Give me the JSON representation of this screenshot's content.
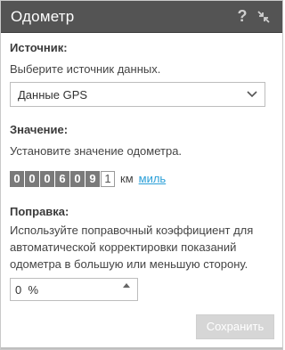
{
  "header": {
    "title": "Одометр",
    "help_symbol": "?"
  },
  "source": {
    "label": "Источник:",
    "hint": "Выберите источник данных.",
    "selected": "Данные GPS"
  },
  "value": {
    "label": "Значение:",
    "hint": "Установите значение одометра.",
    "digits": [
      "0",
      "0",
      "0",
      "6",
      "0",
      "9",
      "1"
    ],
    "unit": "км",
    "unit_alt_link": "миль"
  },
  "correction": {
    "label": "Поправка:",
    "hint_lines": [
      "Используйте поправочный коэффициент для",
      "автоматической корректировки показаний",
      "одометра в большую или меньшую сторону."
    ],
    "value": "0  %"
  },
  "footer": {
    "save_label": "Сохранить"
  },
  "colors": {
    "titlebar": "#545454",
    "link": "#2a9fd8",
    "digit_bg": "#7a7a7a",
    "disabled_button": "#d6d6d6"
  },
  "icons": {
    "help": "help-icon",
    "collapse": "collapse-icon",
    "dropdown": "chevron-down-icon",
    "spinner_up": "spin-up-icon"
  }
}
